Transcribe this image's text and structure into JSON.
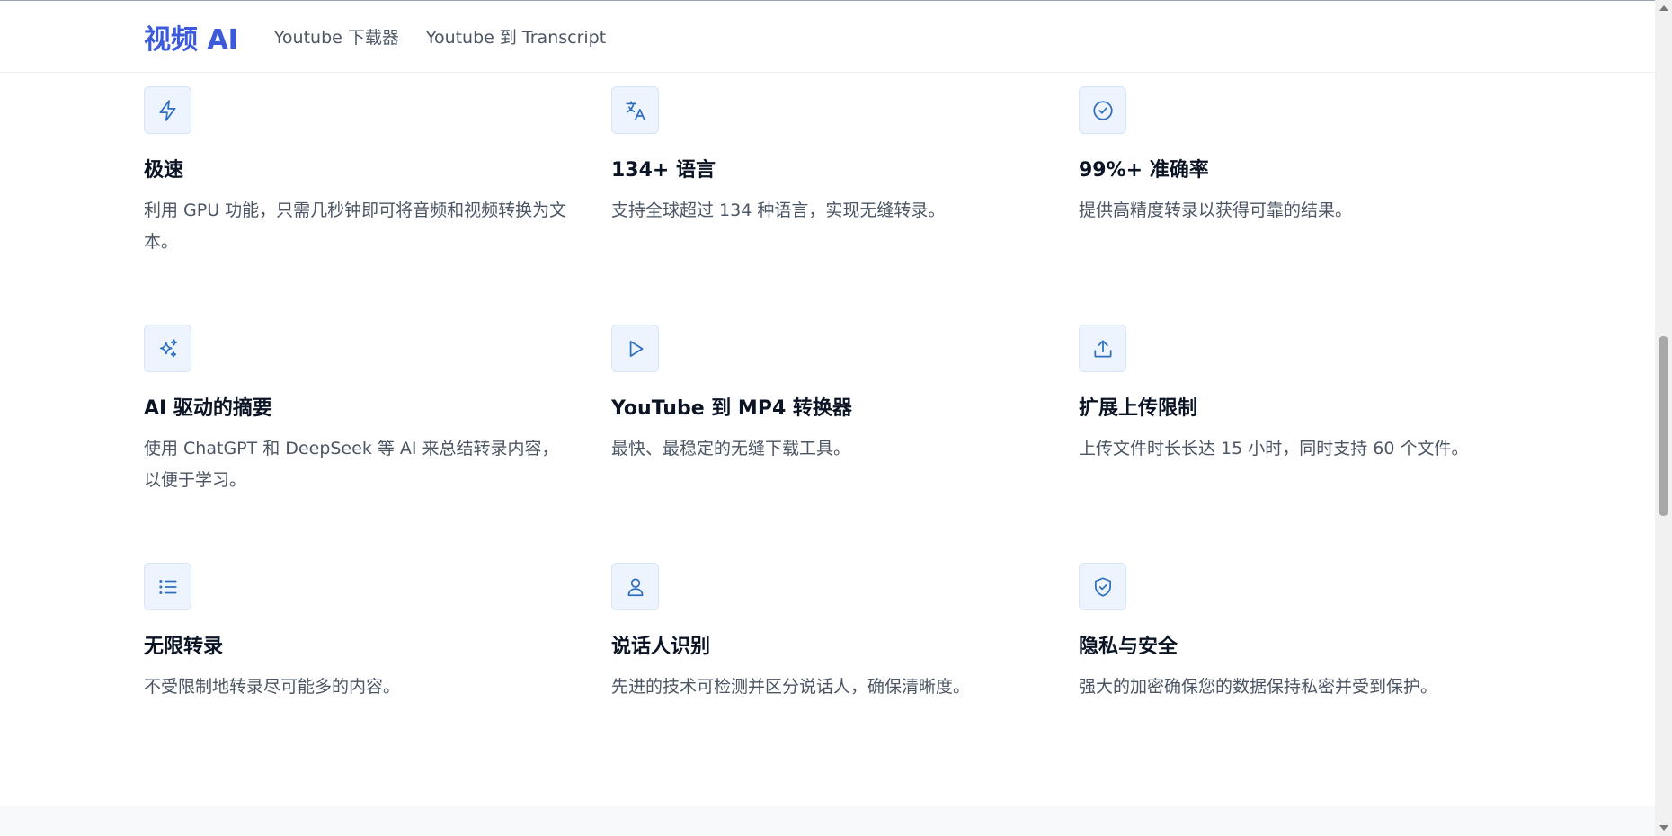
{
  "header": {
    "logo": "视频 AI",
    "nav": [
      "Youtube 下载器",
      "Youtube 到 Transcript"
    ]
  },
  "colors": {
    "brand": "#3b5bdb",
    "icon_stroke": "#2f6fc0",
    "icon_bg": "#eef4fd"
  },
  "features": [
    {
      "icon": "lightning-icon",
      "title": "极速",
      "desc": "利用 GPU 功能，只需几秒钟即可将音频和视频转换为文本。"
    },
    {
      "icon": "translate-icon",
      "title": "134+ 语言",
      "desc": "支持全球超过 134 种语言，实现无缝转录。"
    },
    {
      "icon": "check-circle-icon",
      "title": "99%+ 准确率",
      "desc": "提供高精度转录以获得可靠的结果。"
    },
    {
      "icon": "sparkles-icon",
      "title": "AI 驱动的摘要",
      "desc": "使用 ChatGPT 和 DeepSeek 等 AI 来总结转录内容，以便于学习。"
    },
    {
      "icon": "play-icon",
      "title": "YouTube 到 MP4 转换器",
      "desc": "最快、最稳定的无缝下载工具。"
    },
    {
      "icon": "upload-icon",
      "title": "扩展上传限制",
      "desc": "上传文件时长长达 15 小时，同时支持 60 个文件。"
    },
    {
      "icon": "list-icon",
      "title": "无限转录",
      "desc": "不受限制地转录尽可能多的内容。"
    },
    {
      "icon": "user-icon",
      "title": "说话人识别",
      "desc": "先进的技术可检测并区分说话人，确保清晰度。"
    },
    {
      "icon": "shield-check-icon",
      "title": "隐私与安全",
      "desc": "强大的加密确保您的数据保持私密并受到保护。"
    }
  ]
}
